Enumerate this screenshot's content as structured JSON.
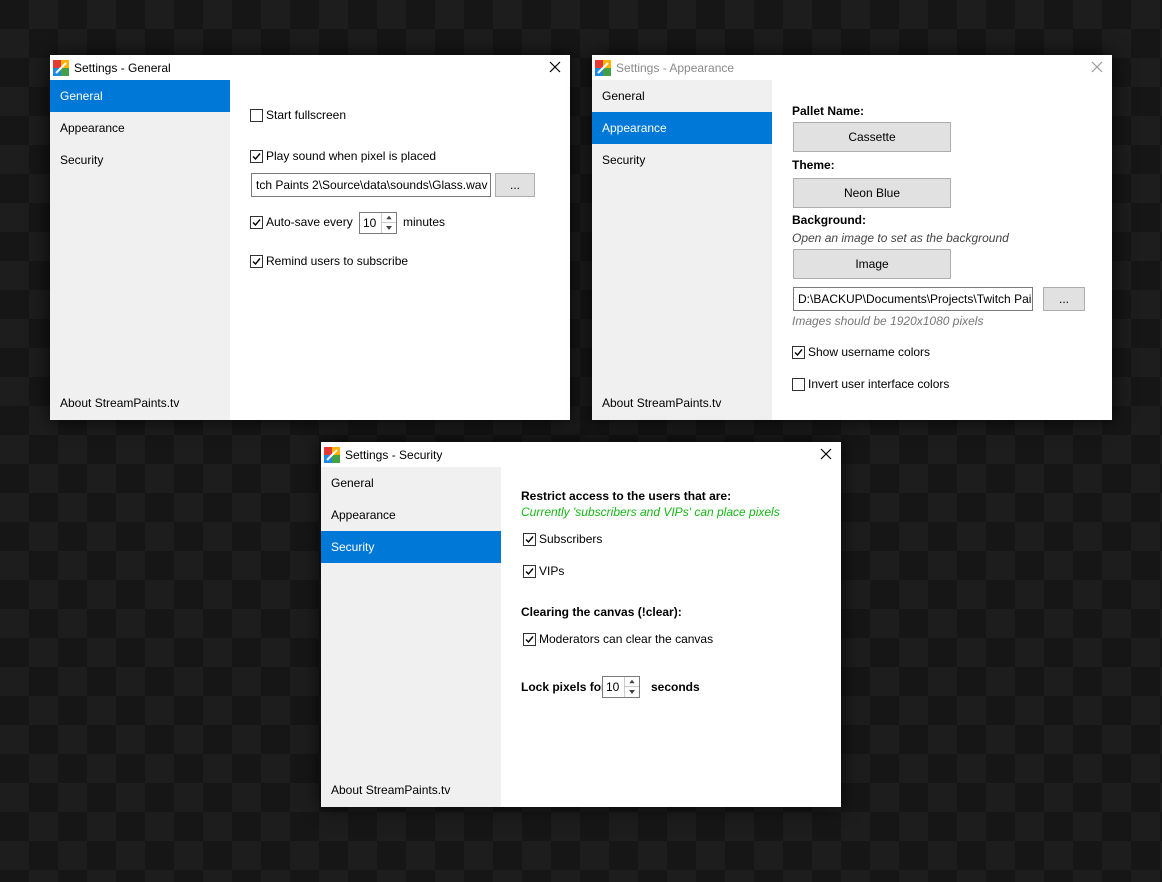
{
  "nav": {
    "general": "General",
    "appearance": "Appearance",
    "security": "Security",
    "about": "About StreamPaints.tv"
  },
  "general_window": {
    "title": "Settings - General",
    "start_fullscreen": {
      "label": "Start fullscreen",
      "checked": false
    },
    "play_sound": {
      "label": "Play sound when pixel is placed",
      "checked": true
    },
    "sound_path": "tch Paints 2\\Source\\data\\sounds\\Glass.wav",
    "browse_label": "...",
    "autosave": {
      "label": "Auto-save every",
      "checked": true,
      "value": "10",
      "unit": "minutes"
    },
    "remind": {
      "label": "Remind users to subscribe",
      "checked": true
    }
  },
  "appearance_window": {
    "title": "Settings - Appearance",
    "pallet_label": "Pallet Name:",
    "pallet_value": "Cassette",
    "theme_label": "Theme:",
    "theme_value": "Neon Blue",
    "background_label": "Background:",
    "background_hint": "Open an image to set as the background",
    "image_button": "Image",
    "image_path": "D:\\BACKUP\\Documents\\Projects\\Twitch Pai",
    "browse_label": "...",
    "size_hint": "Images should be 1920x1080 pixels",
    "show_colors": {
      "label": "Show username colors",
      "checked": true
    },
    "invert": {
      "label": "Invert user interface colors",
      "checked": false
    }
  },
  "security_window": {
    "title": "Settings - Security",
    "restrict_label": "Restrict access to the users that are:",
    "status": "Currently 'subscribers and VIPs' can place pixels",
    "subscribers": {
      "label": "Subscribers",
      "checked": true
    },
    "vips": {
      "label": "VIPs",
      "checked": true
    },
    "clear_label": "Clearing the canvas (!clear):",
    "moderators": {
      "label": "Moderators can clear the canvas",
      "checked": true
    },
    "lock_label": "Lock pixels for",
    "lock_value": "10",
    "lock_unit": "seconds"
  },
  "colors": {
    "accent": "#0078d7",
    "status_green": "#16b716",
    "sidebar": "#f0f0f0"
  }
}
